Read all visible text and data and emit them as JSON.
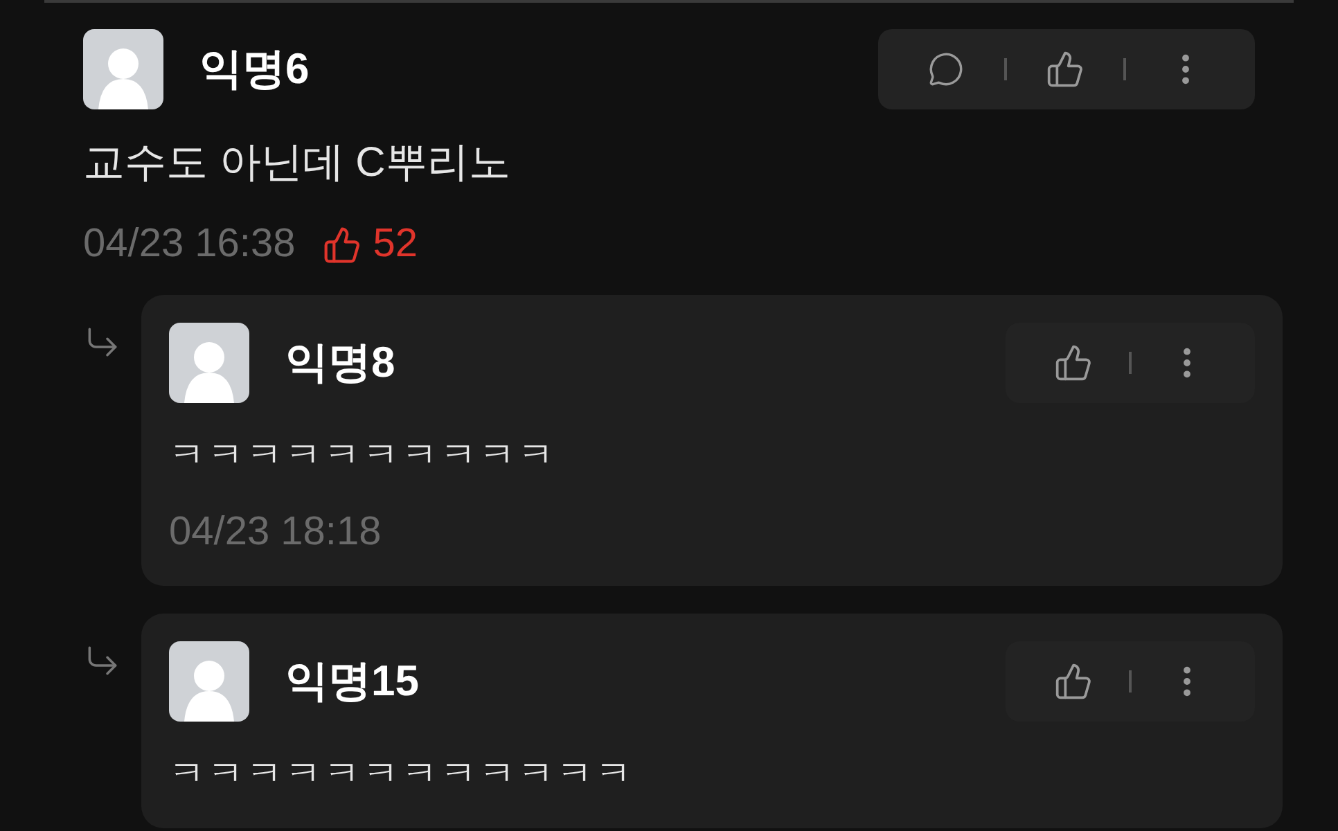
{
  "comment": {
    "author": "익명6",
    "text": "교수도 아닌데 C뿌리노",
    "time": "04/23 16:38",
    "likes": "52",
    "actions": [
      {
        "kind": "reply"
      },
      {
        "kind": "like"
      },
      {
        "kind": "more"
      }
    ]
  },
  "replies": [
    {
      "author": "익명8",
      "text": "ㅋㅋㅋㅋㅋㅋㅋㅋㅋㅋ",
      "time": "04/23 18:18",
      "actions": [
        {
          "kind": "like"
        },
        {
          "kind": "more"
        }
      ]
    },
    {
      "author": "익명15",
      "text": "ㅋㅋㅋㅋㅋㅋㅋㅋㅋㅋㅋㅋ",
      "actions": [
        {
          "kind": "like"
        },
        {
          "kind": "more"
        }
      ]
    }
  ]
}
